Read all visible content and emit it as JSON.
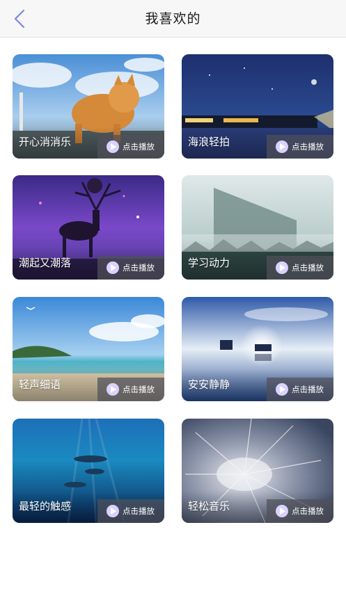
{
  "header": {
    "title": "我喜欢的",
    "back_icon": "chevron-left-icon"
  },
  "play_label": "点击播放",
  "play_icon": "play-icon",
  "items": [
    {
      "title": "开心消消乐"
    },
    {
      "title": "海浪轻拍"
    },
    {
      "title": "潮起又潮落"
    },
    {
      "title": "学习动力"
    },
    {
      "title": "轻声细语"
    },
    {
      "title": "安安静静"
    },
    {
      "title": "最轻的触感"
    },
    {
      "title": "轻松音乐"
    }
  ],
  "colors": {
    "accent": "#7c86e0",
    "play_icon_fill": "#d9d2ff"
  }
}
